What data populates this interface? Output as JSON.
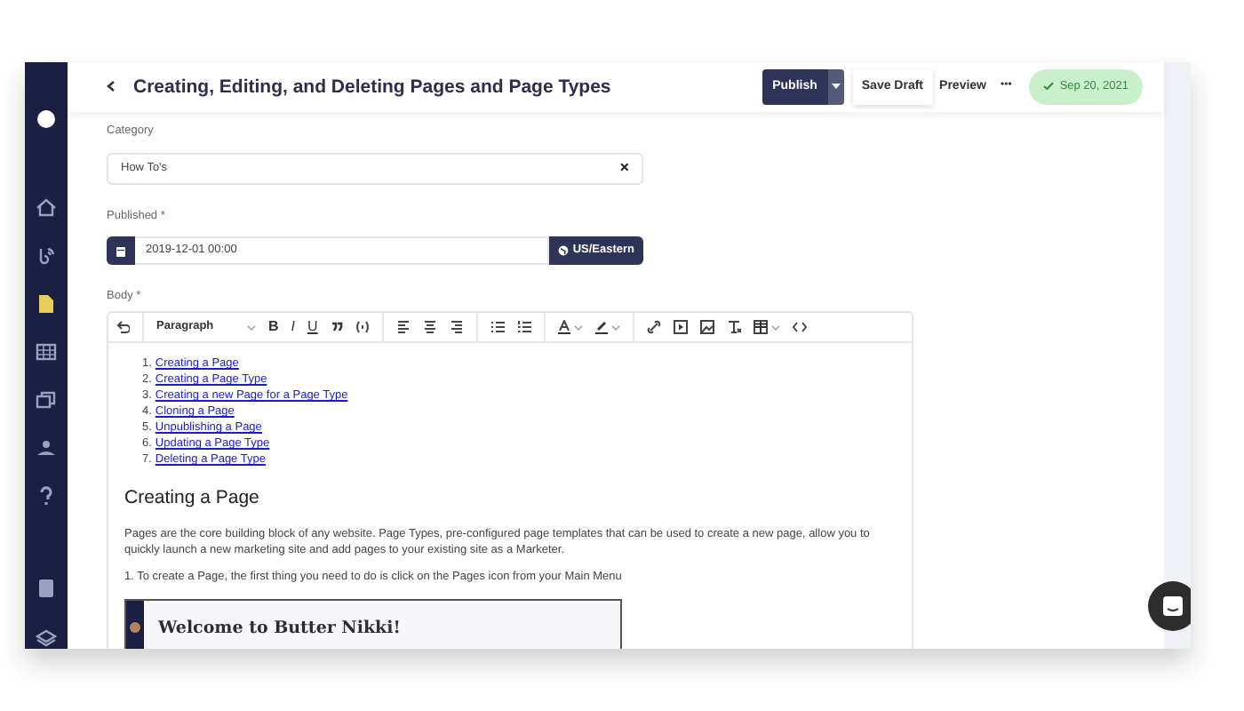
{
  "sidebar": {
    "items": [
      {
        "selected": false
      },
      {
        "selected": false
      },
      {
        "selected": true
      },
      {
        "selected": false
      },
      {
        "selected": false
      },
      {
        "selected": false
      },
      {
        "selected": false
      },
      {
        "selected": false
      },
      {
        "selected": false
      }
    ]
  },
  "header": {
    "title": "Creating, Editing, and Deleting Pages and Page Types",
    "publish": "Publish",
    "save_draft": "Save Draft",
    "preview": "Preview",
    "more": "•••",
    "status": "Sep 20, 2021"
  },
  "category": {
    "label": "Category",
    "value": "How To's",
    "clear": "×"
  },
  "published": {
    "label": "Published *",
    "value": "2019-12-01 00:00",
    "timezone": "US/Eastern"
  },
  "body": {
    "label": "Body *",
    "toolbar": {
      "block_format": "Paragraph",
      "bold": "B",
      "italic": "I",
      "underline": "U"
    },
    "toc": [
      {
        "marker": "1.",
        "text": "Creating a Page"
      },
      {
        "marker": "2.",
        "text": "Creating a Page Type"
      },
      {
        "marker": "3.",
        "text": "Creating a new Page for a Page Type"
      },
      {
        "marker": "4.",
        "text": "Cloning a Page"
      },
      {
        "marker": "5.",
        "text": "Unpublishing a Page"
      },
      {
        "marker": "6.",
        "text": "Updating a Page Type"
      },
      {
        "marker": "7.",
        "text": "Deleting a Page Type"
      }
    ],
    "heading": "Creating a Page",
    "paragraphs": [
      "Pages are the core building block of any website.  Page Types, pre-configured page templates that can be used to create a new page, allow you to quickly launch a new marketing site and add pages to your existing site as a Marketer.",
      "1. To create a Page, the first thing you need to do is click on the Pages icon from your Main Menu"
    ],
    "embedded_heading": "Welcome to Butter Nikki!"
  }
}
